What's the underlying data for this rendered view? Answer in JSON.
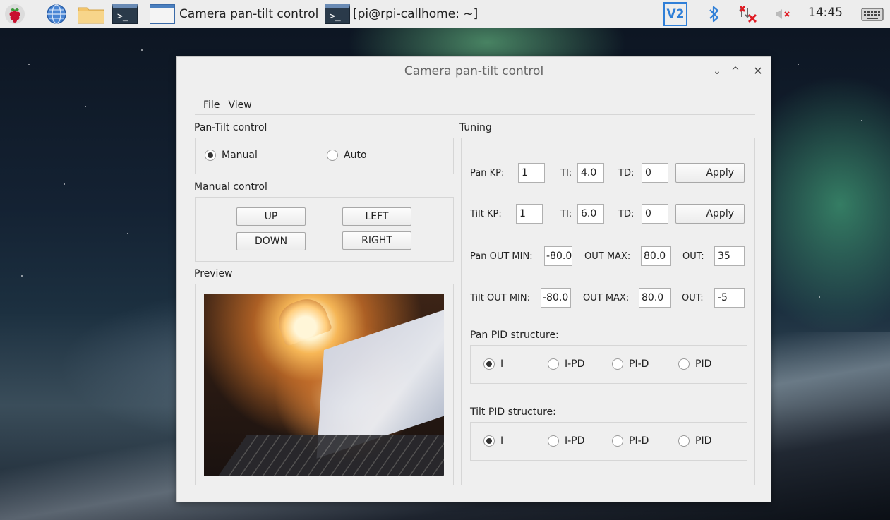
{
  "taskbar": {
    "tasks": [
      {
        "label": "Camera pan-tilt control"
      },
      {
        "label": "[pi@rpi-callhome: ~]"
      }
    ],
    "terminal_glyph": ">_",
    "vnc_label": "V2",
    "clock": "14:45",
    "icons": [
      "raspberry-menu-icon",
      "browser-globe-icon",
      "file-manager-folder-icon",
      "terminal-icon",
      "vnc-icon",
      "bluetooth-icon",
      "network-disconnected-icon",
      "volume-muted-icon",
      "keyboard-icon"
    ]
  },
  "window": {
    "title": "Camera pan-tilt control",
    "controls": {
      "minimize": "⌄",
      "maximize": "^",
      "close": "✕"
    },
    "menu": [
      "File",
      "View"
    ],
    "pan_tilt": {
      "group_label": "Pan-Tilt control",
      "options": [
        {
          "label": "Manual",
          "selected": true
        },
        {
          "label": "Auto",
          "selected": false
        }
      ]
    },
    "manual": {
      "group_label": "Manual control",
      "buttons": {
        "up": "UP",
        "left": "LEFT",
        "down": "DOWN",
        "right": "RIGHT"
      }
    },
    "preview": {
      "group_label": "Preview"
    },
    "tuning": {
      "group_label": "Tuning",
      "pan_row": {
        "label": "Pan  KP:",
        "kp": "1",
        "ti_label": "TI:",
        "ti": "4.0",
        "td_label": "TD:",
        "td": "0",
        "apply": "Apply"
      },
      "tilt_row": {
        "label": "Tilt  KP:",
        "kp": "1",
        "ti_label": "TI:",
        "ti": "6.0",
        "td_label": "TD:",
        "td": "0",
        "apply": "Apply"
      },
      "pan_out": {
        "min_label": "Pan OUT MIN:",
        "min": "-80.0",
        "max_label": "OUT MAX:",
        "max": "80.0",
        "out_label": "OUT:",
        "out": "35"
      },
      "tilt_out": {
        "min_label": "Tilt OUT MIN:",
        "min": "-80.0",
        "max_label": "OUT MAX:",
        "max": "80.0",
        "out_label": "OUT:",
        "out": "-5"
      },
      "pan_pid": {
        "label": "Pan PID structure:",
        "options": [
          {
            "label": "I",
            "selected": true
          },
          {
            "label": "I-PD",
            "selected": false
          },
          {
            "label": "PI-D",
            "selected": false
          },
          {
            "label": "PID",
            "selected": false
          }
        ]
      },
      "tilt_pid": {
        "label": "Tilt PID structure:",
        "options": [
          {
            "label": "I",
            "selected": true
          },
          {
            "label": "I-PD",
            "selected": false
          },
          {
            "label": "PI-D",
            "selected": false
          },
          {
            "label": "PID",
            "selected": false
          }
        ]
      }
    }
  }
}
